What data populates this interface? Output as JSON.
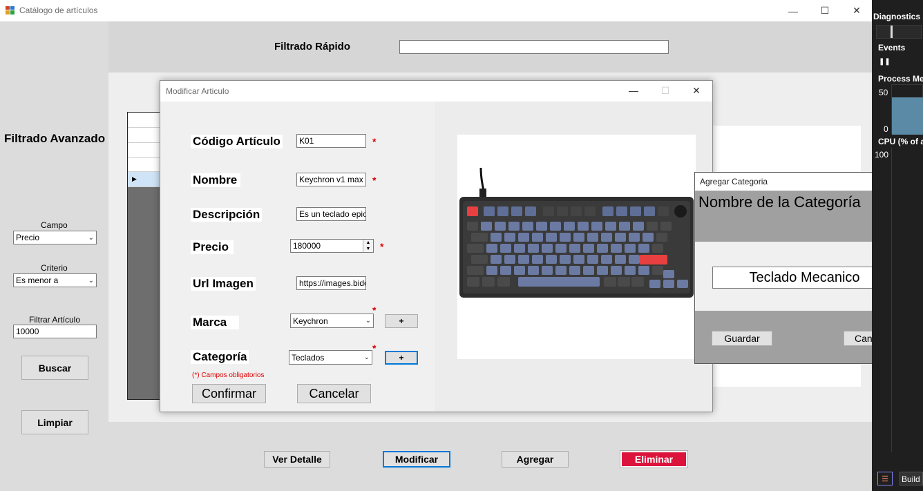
{
  "main": {
    "title": "Catálogo de artículos",
    "quick_filter_label": "Filtrado Rápido",
    "quick_filter_value": "",
    "advanced_filter_label": "Filtrado Avanzado",
    "field_label": "Campo",
    "field_value": "Precio",
    "criteria_label": "Criterio",
    "criteria_value": "Es menor a",
    "filter_article_label": "Filtrar Artículo",
    "filter_article_value": "10000",
    "search_button": "Buscar",
    "clear_button": "Limpiar",
    "view_detail_button": "Ver Detalle",
    "modify_button": "Modificar",
    "add_button": "Agregar",
    "delete_button": "Eliminar"
  },
  "modify": {
    "title": "Modificar Articulo",
    "code_label": "Código Artículo",
    "code_value": "K01",
    "name_label": "Nombre",
    "name_value": "Keychron v1 max",
    "desc_label": "Descripción",
    "desc_value": "Es un teclado epico",
    "price_label": "Precio",
    "price_value": "180000",
    "url_label": "Url Imagen",
    "url_value": "https://images.bidcc",
    "brand_label": "Marca",
    "brand_value": "Keychron",
    "category_label": "Categoría",
    "category_value": "Teclados",
    "add_symbol": "+",
    "required_star": "*",
    "required_note": "(*) Campos obligatorios",
    "confirm_button": "Confirmar",
    "cancel_button": "Cancelar"
  },
  "category": {
    "title": "Agregar Categoria",
    "close_symbol": "x",
    "name_label": "Nombre de la Categoría",
    "name_value": "Teclado Mecanico",
    "save_button": "Guardar",
    "cancel_button": "Cancelar"
  },
  "diagnostics": {
    "title": "Diagnostics s",
    "events_label": "Events",
    "process_memory_label": "Process Mer",
    "mem_max": "50",
    "mem_min": "0",
    "cpu_label": "CPU (% of a",
    "cpu_max": "100",
    "build_label": "Build"
  },
  "colors": {
    "delete_red": "#dc143c",
    "focus_blue": "#0078d7",
    "diag_bg": "#1f1f1f"
  }
}
